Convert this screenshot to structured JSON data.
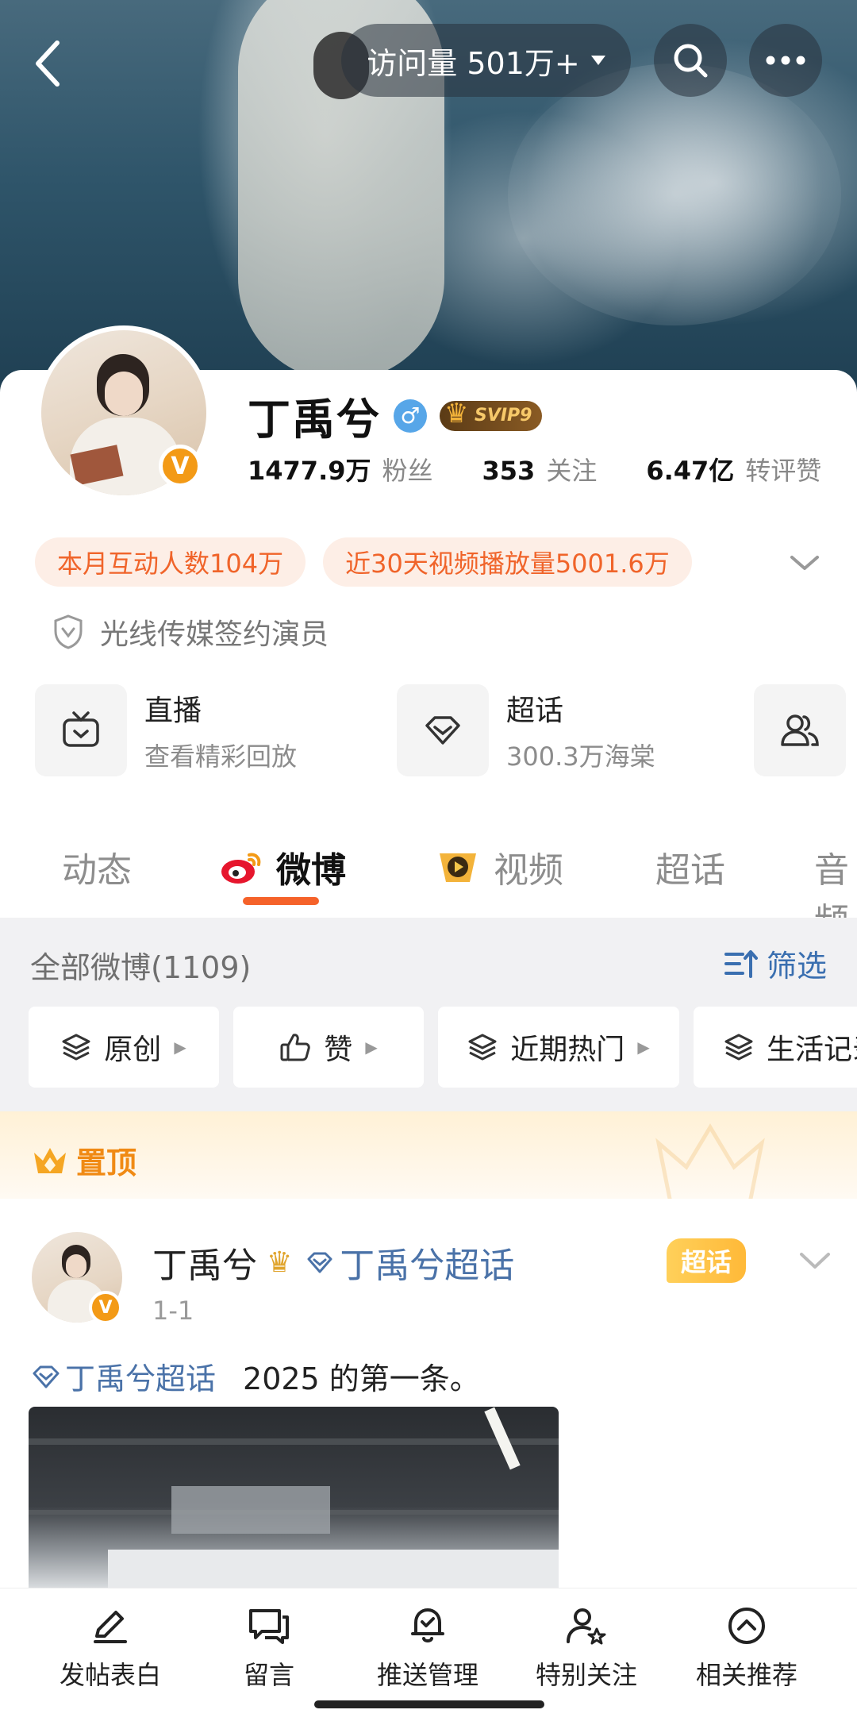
{
  "header": {
    "visit_label": "访问量 501万+",
    "icons": [
      "back-arrow-icon",
      "search-icon",
      "more-icon",
      "chevron-down-icon"
    ]
  },
  "profile": {
    "name": "丁禹兮",
    "vip_badge": "SVIP9",
    "gender": "♂",
    "verified_mark": "V",
    "stats": [
      {
        "value": "1477.9万",
        "label": "粉丝"
      },
      {
        "value": "353",
        "label": "关注"
      },
      {
        "value": "6.47亿",
        "label": "转评赞"
      }
    ],
    "chips": [
      "本月互动人数104万",
      "近30天视频播放量5001.6万"
    ],
    "verification": "光线传媒签约演员",
    "entries": {
      "live": {
        "title": "直播",
        "subtitle": "查看精彩回放"
      },
      "topic": {
        "title": "超话",
        "subtitle": "300.3万海棠"
      }
    }
  },
  "tabs": [
    {
      "label": "动态",
      "active": false
    },
    {
      "label": "微博",
      "active": true
    },
    {
      "label": "视频",
      "active": false
    },
    {
      "label": "超话",
      "active": false
    },
    {
      "label": "音频",
      "active": false
    }
  ],
  "filters": {
    "all_label": "全部微博(1109)",
    "filter_label": "筛选",
    "pills": [
      "原创",
      "赞",
      "近期热门",
      "生活记录"
    ]
  },
  "pinned": {
    "label": "置顶"
  },
  "post": {
    "author": "丁禹兮",
    "topic_link": "丁禹兮超话",
    "tag": "超话",
    "date": "1-1",
    "topic_inline": "丁禹兮超话",
    "text": "2025 的第一条。"
  },
  "bottom_bar": [
    {
      "label": "发帖表白",
      "icon": "pencil-icon"
    },
    {
      "label": "留言",
      "icon": "message-icon"
    },
    {
      "label": "推送管理",
      "icon": "bell-check-icon"
    },
    {
      "label": "特别关注",
      "icon": "user-star-icon"
    },
    {
      "label": "相关推荐",
      "icon": "chevron-up-circle-icon"
    }
  ],
  "colors": {
    "accent_orange": "#f5622a",
    "link_blue": "#4a72a8",
    "chip_bg": "#fdeee6",
    "vip_gold": "#f39a16"
  }
}
